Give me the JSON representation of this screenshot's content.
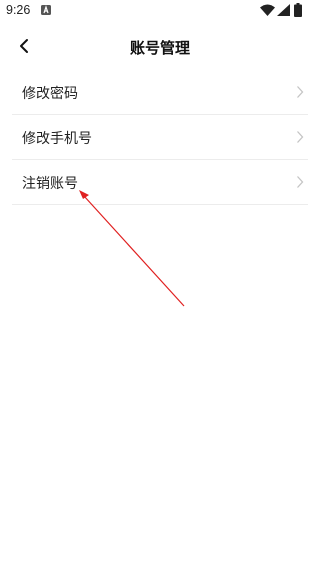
{
  "status_bar": {
    "time": "9:26",
    "notification_icon": "a-letter-icon",
    "icons": [
      "wifi-icon",
      "signal-icon",
      "battery-icon"
    ]
  },
  "header": {
    "back_icon": "chevron-left-icon",
    "title": "账号管理"
  },
  "menu": {
    "items": [
      {
        "label": "修改密码",
        "icon": "chevron-right-icon"
      },
      {
        "label": "修改手机号",
        "icon": "chevron-right-icon"
      },
      {
        "label": "注销账号",
        "icon": "chevron-right-icon"
      }
    ]
  },
  "annotation": {
    "color": "#e02020",
    "points_to": "注销账号"
  },
  "colors": {
    "background": "#ffffff",
    "divider": "#ececec",
    "chevron": "#c4c4c4"
  }
}
